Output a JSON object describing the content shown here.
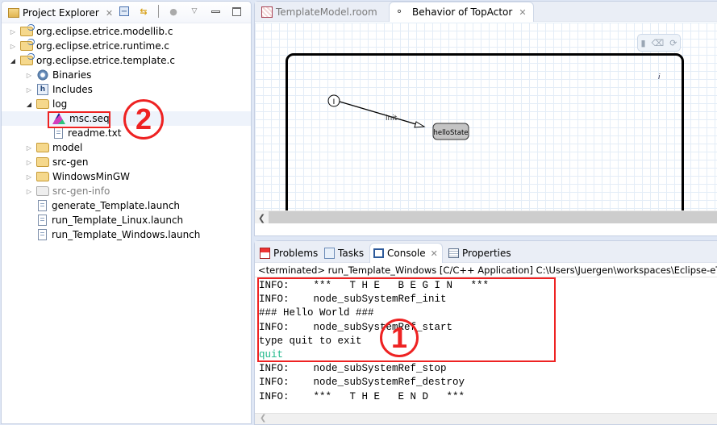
{
  "explorer": {
    "title": "Project Explorer",
    "toolbar_icons": [
      "collapse-all-icon",
      "link-with-editor-icon",
      "filter-icon",
      "view-menu-icon",
      "minimize-icon",
      "maximize-icon"
    ],
    "tree": [
      {
        "label": "org.eclipse.etrice.modellib.c",
        "level": 0,
        "type": "project",
        "expanded": false
      },
      {
        "label": "org.eclipse.etrice.runtime.c",
        "level": 0,
        "type": "project",
        "expanded": false
      },
      {
        "label": "org.eclipse.etrice.template.c",
        "level": 0,
        "type": "project",
        "expanded": true
      },
      {
        "label": "Binaries",
        "level": 1,
        "type": "binaries",
        "expanded": false
      },
      {
        "label": "Includes",
        "level": 1,
        "type": "includes",
        "expanded": false
      },
      {
        "label": "log",
        "level": 1,
        "type": "folder",
        "expanded": true
      },
      {
        "label": "msc.seq",
        "level": 2,
        "type": "msc-file",
        "highlighted": true
      },
      {
        "label": "readme.txt",
        "level": 2,
        "type": "file"
      },
      {
        "label": "model",
        "level": 1,
        "type": "folder",
        "expanded": false
      },
      {
        "label": "src-gen",
        "level": 1,
        "type": "folder",
        "expanded": false
      },
      {
        "label": "WindowsMinGW",
        "level": 1,
        "type": "folder",
        "expanded": false
      },
      {
        "label": "src-gen-info",
        "level": 1,
        "type": "derived-folder",
        "expanded": false
      },
      {
        "label": "generate_Template.launch",
        "level": 1,
        "type": "file"
      },
      {
        "label": "run_Template_Linux.launch",
        "level": 1,
        "type": "file"
      },
      {
        "label": "run_Template_Windows.launch",
        "level": 1,
        "type": "file"
      }
    ]
  },
  "annotations": {
    "one": "1",
    "two": "2",
    "color": "#e22222"
  },
  "editor": {
    "tabs": [
      {
        "label": "TemplateModel.room",
        "active": false
      },
      {
        "label": "Behavior of TopActor",
        "active": true
      }
    ],
    "diagram": {
      "initial_point_label": "I",
      "transition_label": "init",
      "state_label": "helloState",
      "info_marker": "i",
      "palette_icons": [
        "delete-icon",
        "eraser-icon",
        "refresh-icon"
      ]
    }
  },
  "console": {
    "tabs": [
      {
        "label": "Problems",
        "active": false
      },
      {
        "label": "Tasks",
        "active": false
      },
      {
        "label": "Console",
        "active": true
      },
      {
        "label": "Properties",
        "active": false
      }
    ],
    "header": "<terminated> run_Template_Windows [C/C++ Application] C:\\Users\\Juergen\\workspaces\\Eclipse-eTrice\\eTrice",
    "lines": [
      {
        "text": "INFO:    ***   T H E   B E G I N   ***",
        "kind": "output"
      },
      {
        "text": "INFO:    node_subSystemRef_init",
        "kind": "output"
      },
      {
        "text": "### Hello World ###",
        "kind": "output"
      },
      {
        "text": "INFO:    node_subSystemRef_start",
        "kind": "output"
      },
      {
        "text": "type quit to exit",
        "kind": "output"
      },
      {
        "text": "quit",
        "kind": "input"
      },
      {
        "text": "INFO:    node_subSystemRef_stop",
        "kind": "output"
      },
      {
        "text": "INFO:    node_subSystemRef_destroy",
        "kind": "output"
      },
      {
        "text": "INFO:    ***   T H E   E N D   ***",
        "kind": "output"
      }
    ],
    "input_color": "#1eb88a"
  }
}
